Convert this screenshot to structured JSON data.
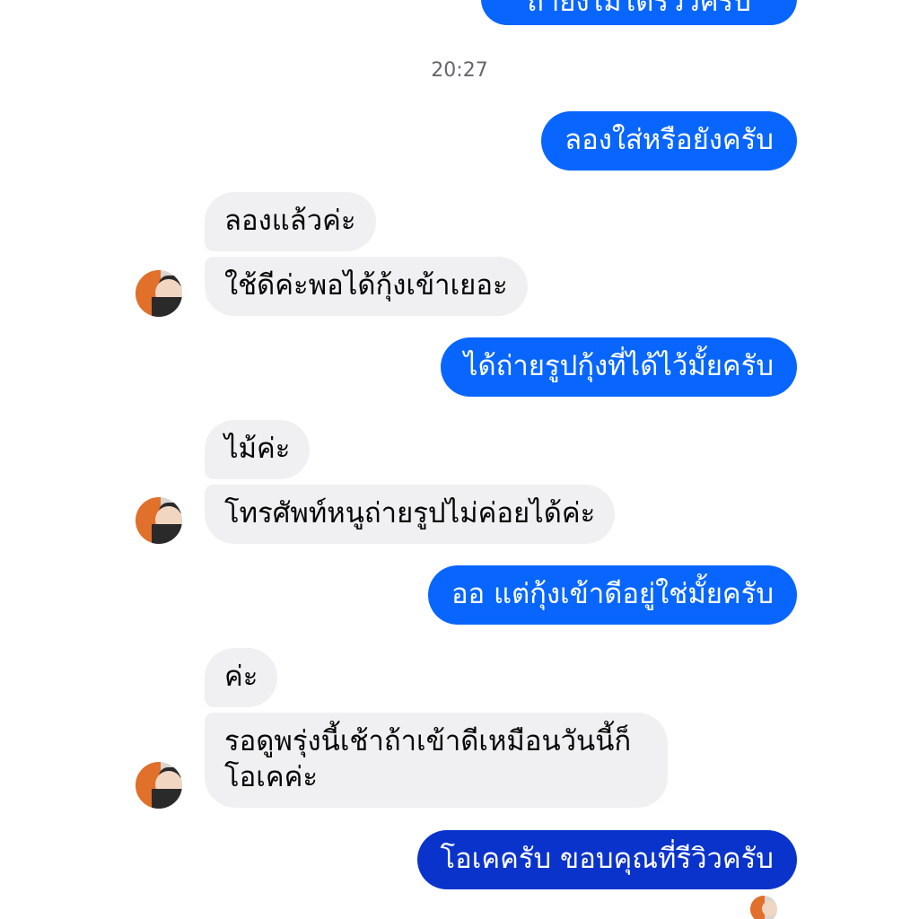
{
  "conversation": {
    "partial_top_message": "ถ้ายังไม่ได้รีวิวครับ",
    "timestamp": "20:27",
    "messages": [
      {
        "direction": "outgoing",
        "text": "ลองใส่หรือยังครับ"
      },
      {
        "direction": "incoming",
        "text": "ลองแล้วค่ะ"
      },
      {
        "direction": "incoming",
        "text": "ใช้ดีค่ะพอได้กุ้งเข้าเยอะ"
      },
      {
        "direction": "outgoing",
        "text": "ได้ถ่ายรูปกุ้งที่ได้ไว้มั้ยครับ"
      },
      {
        "direction": "incoming",
        "text": "ไม้ค่ะ"
      },
      {
        "direction": "incoming",
        "text": "โทรศัพท์หนูถ่ายรูปไม่ค่อยได้ค่ะ"
      },
      {
        "direction": "outgoing",
        "text": "ออ  แต่กุ้งเข้าดีอยู่ใช่มั้ยครับ"
      },
      {
        "direction": "incoming",
        "text": "ค่ะ"
      },
      {
        "direction": "incoming",
        "text": "รอดูพรุ่งนี้เช้าถ้าเข้าดีเหมือนวันนี้ก็โอเคค่ะ"
      },
      {
        "direction": "outgoing",
        "text": "โอเคครับ ขอบคุณที่รีวิวครับ"
      }
    ]
  },
  "colors": {
    "outgoing_bubble": "#0866ff",
    "outgoing_bubble_last": "#0a33cc",
    "incoming_bubble": "#f0f0f2",
    "timestamp_text": "#65676b"
  },
  "icons": {
    "contact_avatar": "avatar-photo",
    "seen_indicator": "seen-avatar"
  }
}
